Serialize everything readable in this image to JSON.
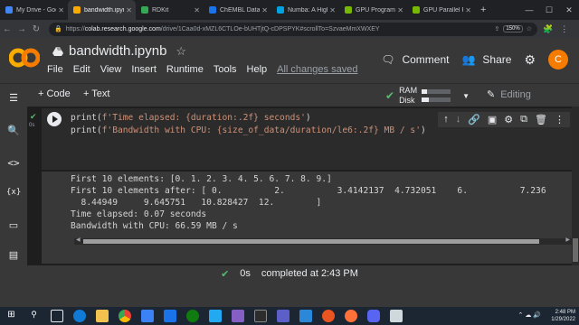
{
  "browser": {
    "tabs": [
      {
        "title": "My Drive - Google",
        "color": "#4285f4"
      },
      {
        "title": "bandwidth.ipynb",
        "color": "#f9ab00",
        "active": true
      },
      {
        "title": "RDKit",
        "color": "#34a853"
      },
      {
        "title": "ChEMBL Database",
        "color": "#1a73e8"
      },
      {
        "title": "Numba: A High P",
        "color": "#00a3e0"
      },
      {
        "title": "GPU Programmin",
        "color": "#76b900"
      },
      {
        "title": "GPU Parallel Progra",
        "color": "#76b900"
      }
    ],
    "new_tab": "+",
    "url_host": "colab.research.google.com",
    "url_prefix": "https://",
    "url_rest": "/drive/1Caa0d-xMZL6CTLOe-bUHTjtQ-cDPSPYK#scrollTo=SzvaeMmXWXEY",
    "zoom": "150%"
  },
  "header": {
    "notebook_title": "bandwidth.ipynb",
    "menu": [
      "File",
      "Edit",
      "View",
      "Insert",
      "Runtime",
      "Tools",
      "Help"
    ],
    "saved_status": "All changes saved",
    "comment_label": "Comment",
    "share_label": "Share",
    "avatar_letter": "C"
  },
  "toolbar": {
    "add_code": "+ Code",
    "add_text": "+ Text",
    "ram_label": "RAM",
    "disk_label": "Disk",
    "ram_usage": 0.2,
    "disk_usage": 0.25,
    "editing_label": "Editing"
  },
  "cell": {
    "exec_time": "0s",
    "code_line1_pre": "print(",
    "code_line1_str": "f'Time elapsed: {duration:.2f} seconds'",
    "code_line1_post": ")",
    "code_line2_pre": "print(",
    "code_line2_str": "f'Bandwidth with CPU: {size_of_data/duration/le6:.2f} MB / s'",
    "code_line2_post": ")",
    "output": "First 10 elements: [0. 1. 2. 3. 4. 5. 6. 7. 8. 9.]\nFirst 10 elements after: [ 0.          2.          3.4142137  4.732051    6.          7.236\n  8.44949     9.645751   10.828427  12.        ]\nTime elapsed: 0.07 seconds\nBandwidth with CPU: 66.59 MB / s"
  },
  "status": {
    "time": "0s",
    "completed": "completed at 2:43 PM"
  },
  "taskbar": {
    "time": "2:48 PM",
    "date": "1/29/2022"
  },
  "colors": {
    "accent_green": "#5bb974",
    "avatar_orange": "#f57c00"
  }
}
